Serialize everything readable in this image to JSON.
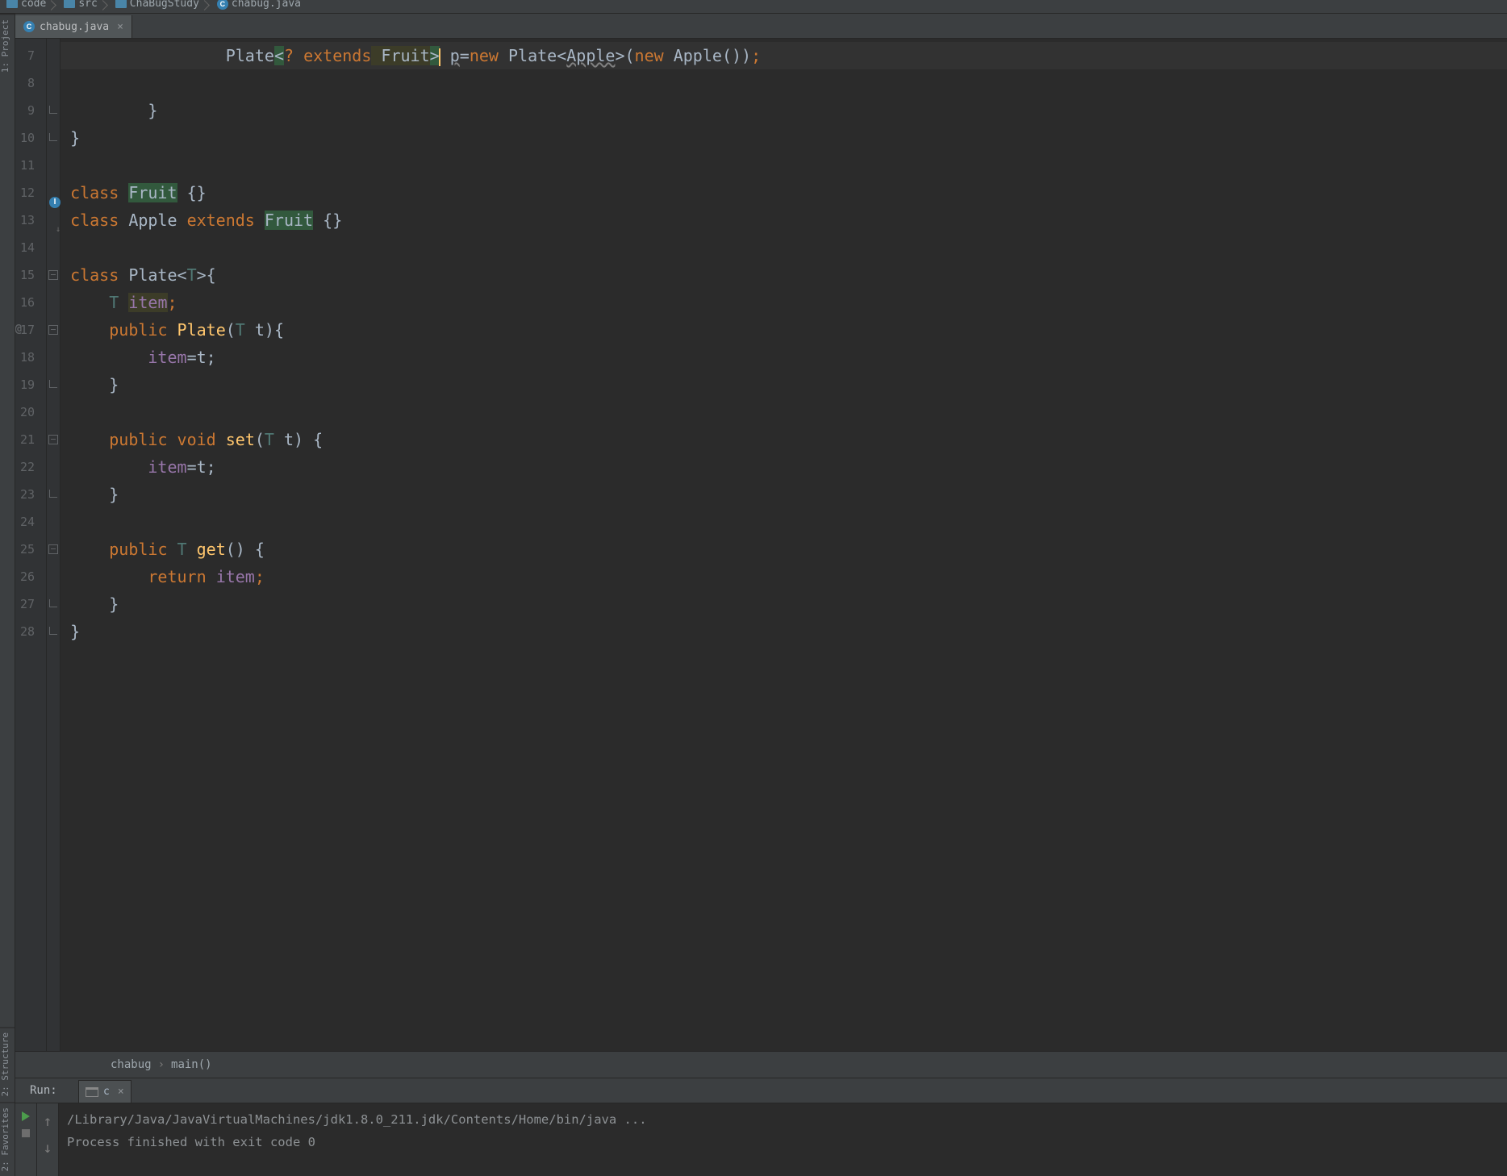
{
  "breadcrumbs": [
    "code",
    "src",
    "ChaBugStudy",
    "chabug.java"
  ],
  "tool_tabs": {
    "project": "1: Project",
    "structure": "2: Structure",
    "favorites": "2: Favorites"
  },
  "tab": {
    "label": "chabug.java"
  },
  "code": {
    "lines": [
      {
        "n": "7",
        "tokens": [
          {
            "w": "                ",
            "c": ""
          },
          {
            "t": "Plate",
            "c": "ty"
          },
          {
            "t": "<",
            "c": "op hl2"
          },
          {
            "t": "? ",
            "c": "kw"
          },
          {
            "t": "extends",
            "c": "kw"
          },
          {
            "t": " Fruit",
            "c": "ty hl3"
          },
          {
            "t": ">",
            "c": "op hl2 cursorpos"
          },
          {
            "t": " ",
            "c": ""
          },
          {
            "t": "p",
            "c": "warn"
          },
          {
            "t": "=",
            "c": "op"
          },
          {
            "t": "new ",
            "c": "kw"
          },
          {
            "t": "Plate<",
            "c": "ty"
          },
          {
            "t": "Apple",
            "c": "warn"
          },
          {
            "t": ">",
            "c": "ty"
          },
          {
            "t": "(",
            "c": "p"
          },
          {
            "t": "new ",
            "c": "kw"
          },
          {
            "t": "Apple",
            "c": "ty"
          },
          {
            "t": "())",
            "c": "p"
          },
          {
            "t": ";",
            "c": "kw"
          }
        ]
      },
      {
        "n": "8",
        "tokens": []
      },
      {
        "n": "9",
        "fold": "close",
        "tokens": [
          {
            "w": "        ",
            "c": ""
          },
          {
            "t": "}",
            "c": "p"
          }
        ]
      },
      {
        "n": "10",
        "fold": "close",
        "tokens": [
          {
            "t": "}",
            "c": "p"
          }
        ]
      },
      {
        "n": "11",
        "tokens": []
      },
      {
        "n": "12",
        "impl": true,
        "tokens": [
          {
            "t": "class ",
            "c": "kw"
          },
          {
            "t": "Fruit",
            "c": "ty hl2"
          },
          {
            "t": " {}",
            "c": "p"
          }
        ]
      },
      {
        "n": "13",
        "tokens": [
          {
            "t": "class ",
            "c": "kw"
          },
          {
            "t": "Apple ",
            "c": "ty"
          },
          {
            "t": "extends ",
            "c": "kw"
          },
          {
            "t": "Fruit",
            "c": "ty hl2"
          },
          {
            "t": " {}",
            "c": "p"
          }
        ]
      },
      {
        "n": "14",
        "tokens": []
      },
      {
        "n": "15",
        "fold": "open",
        "tokens": [
          {
            "t": "class ",
            "c": "kw"
          },
          {
            "t": "Plate",
            "c": "ty"
          },
          {
            "t": "<",
            "c": "op"
          },
          {
            "t": "T",
            "c": "typar"
          },
          {
            "t": ">{",
            "c": "p"
          }
        ]
      },
      {
        "n": "16",
        "tokens": [
          {
            "w": "    ",
            "c": ""
          },
          {
            "t": "T",
            "c": "typar"
          },
          {
            "t": " ",
            "c": ""
          },
          {
            "t": "item",
            "c": "fld hl3"
          },
          {
            "t": ";",
            "c": "kw"
          }
        ]
      },
      {
        "n": "17",
        "override": "@",
        "fold": "open",
        "tokens": [
          {
            "w": "    ",
            "c": ""
          },
          {
            "t": "public ",
            "c": "kw"
          },
          {
            "t": "Plate",
            "c": "em"
          },
          {
            "t": "(",
            "c": "p"
          },
          {
            "t": "T",
            "c": "typar"
          },
          {
            "t": " t){",
            "c": "p"
          }
        ]
      },
      {
        "n": "18",
        "tokens": [
          {
            "w": "        ",
            "c": ""
          },
          {
            "t": "item",
            "c": "fld"
          },
          {
            "t": "=t;",
            "c": "p"
          }
        ]
      },
      {
        "n": "19",
        "fold": "close",
        "tokens": [
          {
            "w": "    ",
            "c": ""
          },
          {
            "t": "}",
            "c": "p"
          }
        ]
      },
      {
        "n": "20",
        "tokens": []
      },
      {
        "n": "21",
        "fold": "open",
        "tokens": [
          {
            "w": "    ",
            "c": ""
          },
          {
            "t": "public ",
            "c": "kw"
          },
          {
            "t": "void ",
            "c": "kw"
          },
          {
            "t": "set",
            "c": "em"
          },
          {
            "t": "(",
            "c": "p"
          },
          {
            "t": "T",
            "c": "typar"
          },
          {
            "t": " t) {",
            "c": "p"
          }
        ]
      },
      {
        "n": "22",
        "tokens": [
          {
            "w": "        ",
            "c": ""
          },
          {
            "t": "item",
            "c": "fld"
          },
          {
            "t": "=t;",
            "c": "p"
          }
        ]
      },
      {
        "n": "23",
        "fold": "close",
        "tokens": [
          {
            "w": "    ",
            "c": ""
          },
          {
            "t": "}",
            "c": "p"
          }
        ]
      },
      {
        "n": "24",
        "tokens": []
      },
      {
        "n": "25",
        "fold": "open",
        "tokens": [
          {
            "w": "    ",
            "c": ""
          },
          {
            "t": "public ",
            "c": "kw"
          },
          {
            "t": "T",
            "c": "typar"
          },
          {
            "t": " ",
            "c": ""
          },
          {
            "t": "get",
            "c": "em"
          },
          {
            "t": "() {",
            "c": "p"
          }
        ]
      },
      {
        "n": "26",
        "tokens": [
          {
            "w": "        ",
            "c": ""
          },
          {
            "t": "return ",
            "c": "kw"
          },
          {
            "t": "item",
            "c": "fld"
          },
          {
            "t": ";",
            "c": "kw"
          }
        ]
      },
      {
        "n": "27",
        "fold": "close",
        "tokens": [
          {
            "w": "    ",
            "c": ""
          },
          {
            "t": "}",
            "c": "p"
          }
        ]
      },
      {
        "n": "28",
        "fold": "close",
        "tokens": [
          {
            "t": "}",
            "c": "p"
          }
        ]
      }
    ]
  },
  "context": {
    "cls": "chabug",
    "mth": "main()"
  },
  "run": {
    "label": "Run:",
    "tab": "c",
    "out_line1": "/Library/Java/JavaVirtualMachines/jdk1.8.0_211.jdk/Contents/Home/bin/java ...",
    "out_line2": "",
    "out_line3": "Process finished with exit code 0"
  }
}
